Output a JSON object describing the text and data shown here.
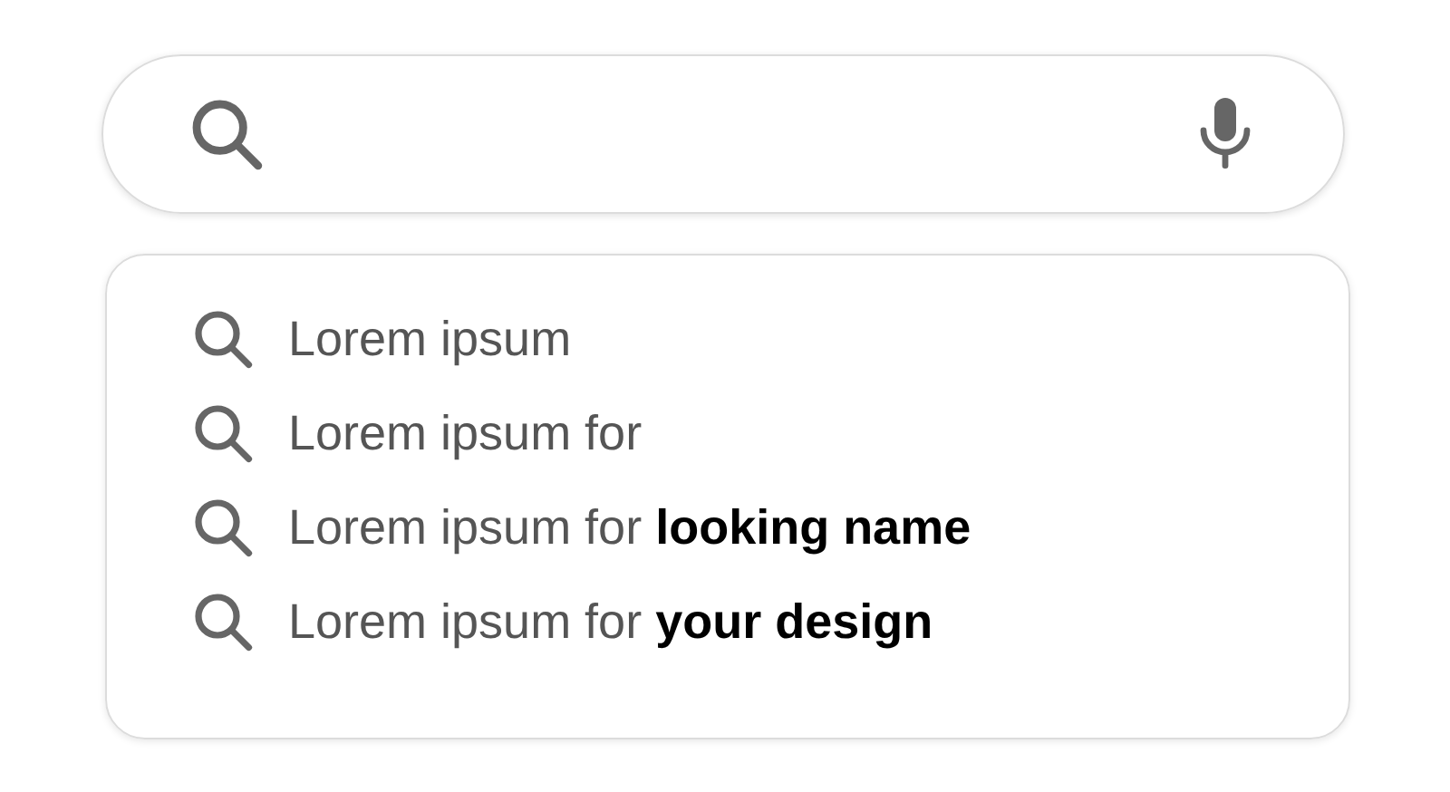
{
  "suggestions": [
    {
      "text": "Lorem ipsum"
    },
    {
      "text": "Lorem ipsum for"
    },
    {
      "text": "Lorem ipsum for **looking name**"
    },
    {
      "text": "Lorem ipsum for **your design**"
    }
  ]
}
